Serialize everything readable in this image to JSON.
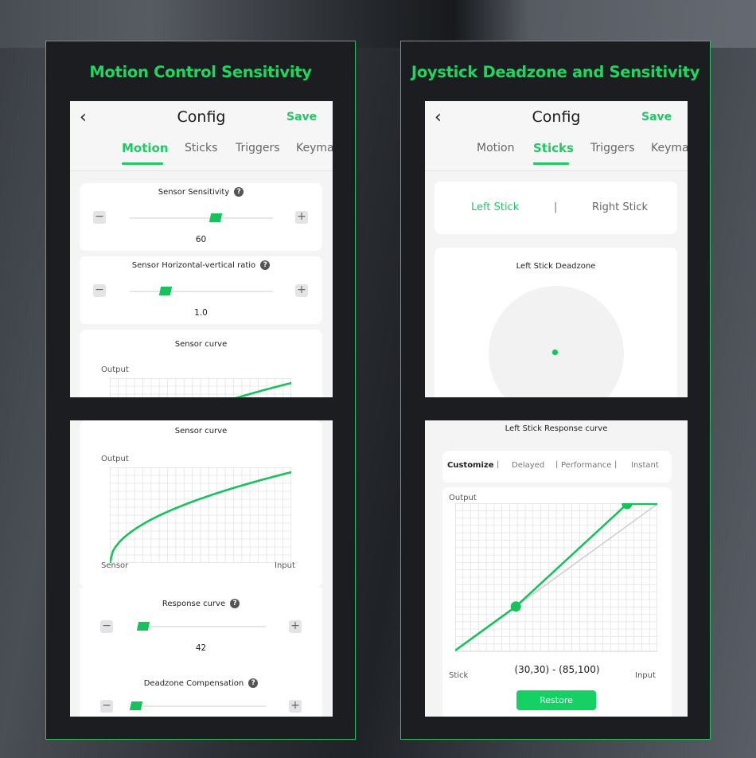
{
  "colors": {
    "accent": "#22c766",
    "panel_border": "#2fbf63",
    "title": "#1fd660"
  },
  "left_panel": {
    "title": "Motion Control Sensitivity",
    "top_screen": {
      "header": {
        "back_icon": "chevron-left-icon",
        "title": "Config",
        "save_label": "Save"
      },
      "tabs": [
        {
          "label": "Motion",
          "active": true
        },
        {
          "label": "Sticks",
          "active": false
        },
        {
          "label": "Triggers",
          "active": false
        },
        {
          "label": "Keymap",
          "active": false
        }
      ],
      "sensor_sensitivity": {
        "label": "Sensor Sensitivity",
        "help_icon": "?",
        "value": "60",
        "slider_fraction": 0.6,
        "minus": "−",
        "plus": "+"
      },
      "hv_ratio": {
        "label": "Sensor Horizontal-vertical ratio",
        "help_icon": "?",
        "value": "1.0",
        "slider_fraction": 0.25,
        "minus": "−",
        "plus": "+"
      },
      "sensor_curve": {
        "label": "Sensor curve",
        "y_label": "Output"
      }
    },
    "bottom_screen": {
      "sensor_curve": {
        "label": "Sensor curve",
        "y_label": "Output",
        "x_label_left": "Sensor",
        "x_label_right": "Input",
        "curve_exponent": 0.5
      },
      "response_curve": {
        "label": "Response curve",
        "help_icon": "?",
        "value": "42",
        "slider_fraction": 0.05,
        "minus": "−",
        "plus": "+"
      },
      "deadzone_comp": {
        "label": "Deadzone Compensation",
        "help_icon": "?",
        "slider_fraction": 0.0,
        "minus": "−",
        "plus": "+"
      }
    }
  },
  "right_panel": {
    "title": "Joystick Deadzone and Sensitivity",
    "top_screen": {
      "header": {
        "back_icon": "chevron-left-icon",
        "title": "Config",
        "save_label": "Save"
      },
      "tabs": [
        {
          "label": "Motion",
          "active": false
        },
        {
          "label": "Sticks",
          "active": true
        },
        {
          "label": "Triggers",
          "active": false
        },
        {
          "label": "Keymap",
          "active": false
        }
      ],
      "stick_selector": {
        "left": "Left Stick",
        "separator": "|",
        "right": "Right Stick",
        "active": "left"
      },
      "deadzone": {
        "label": "Left Stick Deadzone"
      }
    },
    "bottom_screen": {
      "title": "Left Stick Response curve",
      "modes": [
        {
          "label": "Customize",
          "active": true
        },
        {
          "label": "Delayed",
          "active": false
        },
        {
          "label": "Performance",
          "active": false
        },
        {
          "label": "Instant",
          "active": false
        }
      ],
      "separators": [
        "|",
        "|",
        "|"
      ],
      "chart": {
        "y_label": "Output",
        "x_label_left": "Stick",
        "x_label_right": "Input",
        "points": [
          [
            0,
            0
          ],
          [
            30,
            30
          ],
          [
            85,
            100
          ],
          [
            100,
            100
          ]
        ],
        "handles": [
          [
            30,
            30
          ],
          [
            85,
            100
          ]
        ],
        "reference_line": [
          [
            30,
            30
          ],
          [
            100,
            100
          ]
        ],
        "range_text": "(30,30) - (85,100)"
      },
      "restore_label": "Restore"
    }
  }
}
